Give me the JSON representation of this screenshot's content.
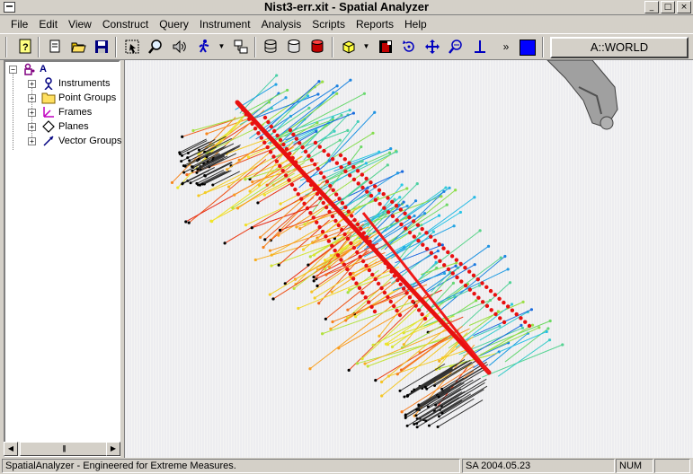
{
  "window": {
    "title": "Nist3-err.xit - Spatial Analyzer"
  },
  "menu": [
    {
      "label": "File"
    },
    {
      "label": "Edit"
    },
    {
      "label": "View"
    },
    {
      "label": "Construct"
    },
    {
      "label": "Query"
    },
    {
      "label": "Instrument"
    },
    {
      "label": "Analysis"
    },
    {
      "label": "Scripts"
    },
    {
      "label": "Reports"
    },
    {
      "label": "Help"
    }
  ],
  "toolbar": {
    "more_label": "»",
    "world_label": "A::WORLD",
    "active_color": "#0000ff"
  },
  "tree": {
    "root_label": "A",
    "items": [
      {
        "label": "Instruments",
        "icon": "instrument-icon"
      },
      {
        "label": "Point Groups",
        "icon": "folder-icon"
      },
      {
        "label": "Frames",
        "icon": "frame-icon"
      },
      {
        "label": "Planes",
        "icon": "plane-icon"
      },
      {
        "label": "Vector Groups",
        "icon": "vector-icon"
      }
    ]
  },
  "status": {
    "message": "SpatialAnalyzer - Engineered for Extreme Measures.",
    "version": "SA 2004.05.23",
    "num": "NUM"
  }
}
